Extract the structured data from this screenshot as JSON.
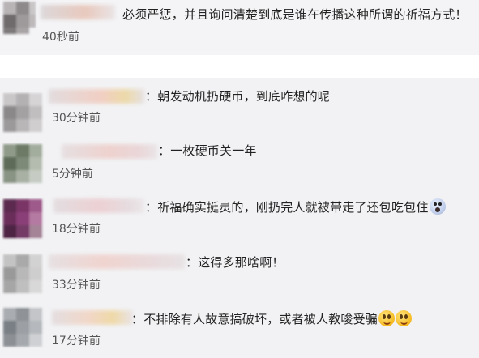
{
  "top_comment": {
    "text": "必须严惩，并且询问清楚到底是谁在传播这种所谓的祈福方式！",
    "time": "40秒前"
  },
  "comments": [
    {
      "prefix": "：",
      "text": "朝发动机扔硬币，到底咋想的呢",
      "time": "30分钟前"
    },
    {
      "prefix": "：",
      "text": "一枚硬币关一年",
      "time": "5分钟前"
    },
    {
      "prefix": "：",
      "text": "祈福确实挺灵的，刚扔完人就被带走了还包吃包住",
      "time": "18分钟前"
    },
    {
      "prefix": "：",
      "text": "这得多那啥啊！",
      "time": "33分钟前"
    },
    {
      "prefix": "：",
      "text": "不排除有人故意搞破坏，或者被人教唆受骗",
      "time": "17分钟前"
    }
  ],
  "icons": {
    "shock_emoji": "shocked-face-icon",
    "grin_emoji": "grinning-face-icon"
  }
}
